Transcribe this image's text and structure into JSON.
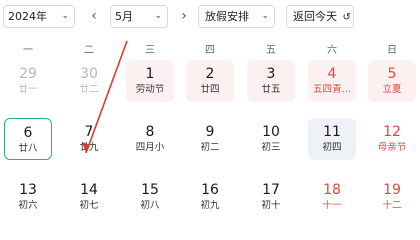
{
  "toolbar": {
    "year_value": "2024年",
    "prev_label": "‹",
    "month_value": "5月",
    "next_label": "›",
    "holiday_select": "放假安排",
    "back_today": "返回今天",
    "chevron": "⌄",
    "refresh_icon": "↺"
  },
  "weekdays": [
    "一",
    "二",
    "三",
    "四",
    "五",
    "六",
    "日"
  ],
  "rows": [
    [
      {
        "day": "29",
        "sub": "廿一",
        "state": "other"
      },
      {
        "day": "30",
        "sub": "廿二",
        "state": "other"
      },
      {
        "day": "1",
        "sub": "劳动节",
        "state": "holiday"
      },
      {
        "day": "2",
        "sub": "廿四",
        "state": "holiday"
      },
      {
        "day": "3",
        "sub": "廿五",
        "state": "holiday"
      },
      {
        "day": "4",
        "sub": "五四青…",
        "state": "holiday-weekend"
      },
      {
        "day": "5",
        "sub": "立夏",
        "state": "holiday-weekend"
      }
    ],
    [
      {
        "day": "6",
        "sub": "廿八",
        "state": "selected"
      },
      {
        "day": "7",
        "sub": "廿九",
        "state": ""
      },
      {
        "day": "8",
        "sub": "四月小",
        "state": ""
      },
      {
        "day": "9",
        "sub": "初二",
        "state": ""
      },
      {
        "day": "10",
        "sub": "初三",
        "state": ""
      },
      {
        "day": "11",
        "sub": "初四",
        "state": "today"
      },
      {
        "day": "12",
        "sub": "母亲节",
        "state": "weekend"
      }
    ],
    [
      {
        "day": "13",
        "sub": "初六",
        "state": ""
      },
      {
        "day": "14",
        "sub": "初七",
        "state": ""
      },
      {
        "day": "15",
        "sub": "初八",
        "state": ""
      },
      {
        "day": "16",
        "sub": "初九",
        "state": ""
      },
      {
        "day": "17",
        "sub": "初十",
        "state": ""
      },
      {
        "day": "18",
        "sub": "十一",
        "state": "weekend"
      },
      {
        "day": "19",
        "sub": "十二",
        "state": "weekend"
      }
    ]
  ],
  "colors": {
    "selected_border": "#2db07a",
    "holiday_bg": "#fdf0f0",
    "weekend_text": "#e04a3c",
    "today_bg": "#eef1f6",
    "annotation_arrow": "#e03a2f"
  }
}
